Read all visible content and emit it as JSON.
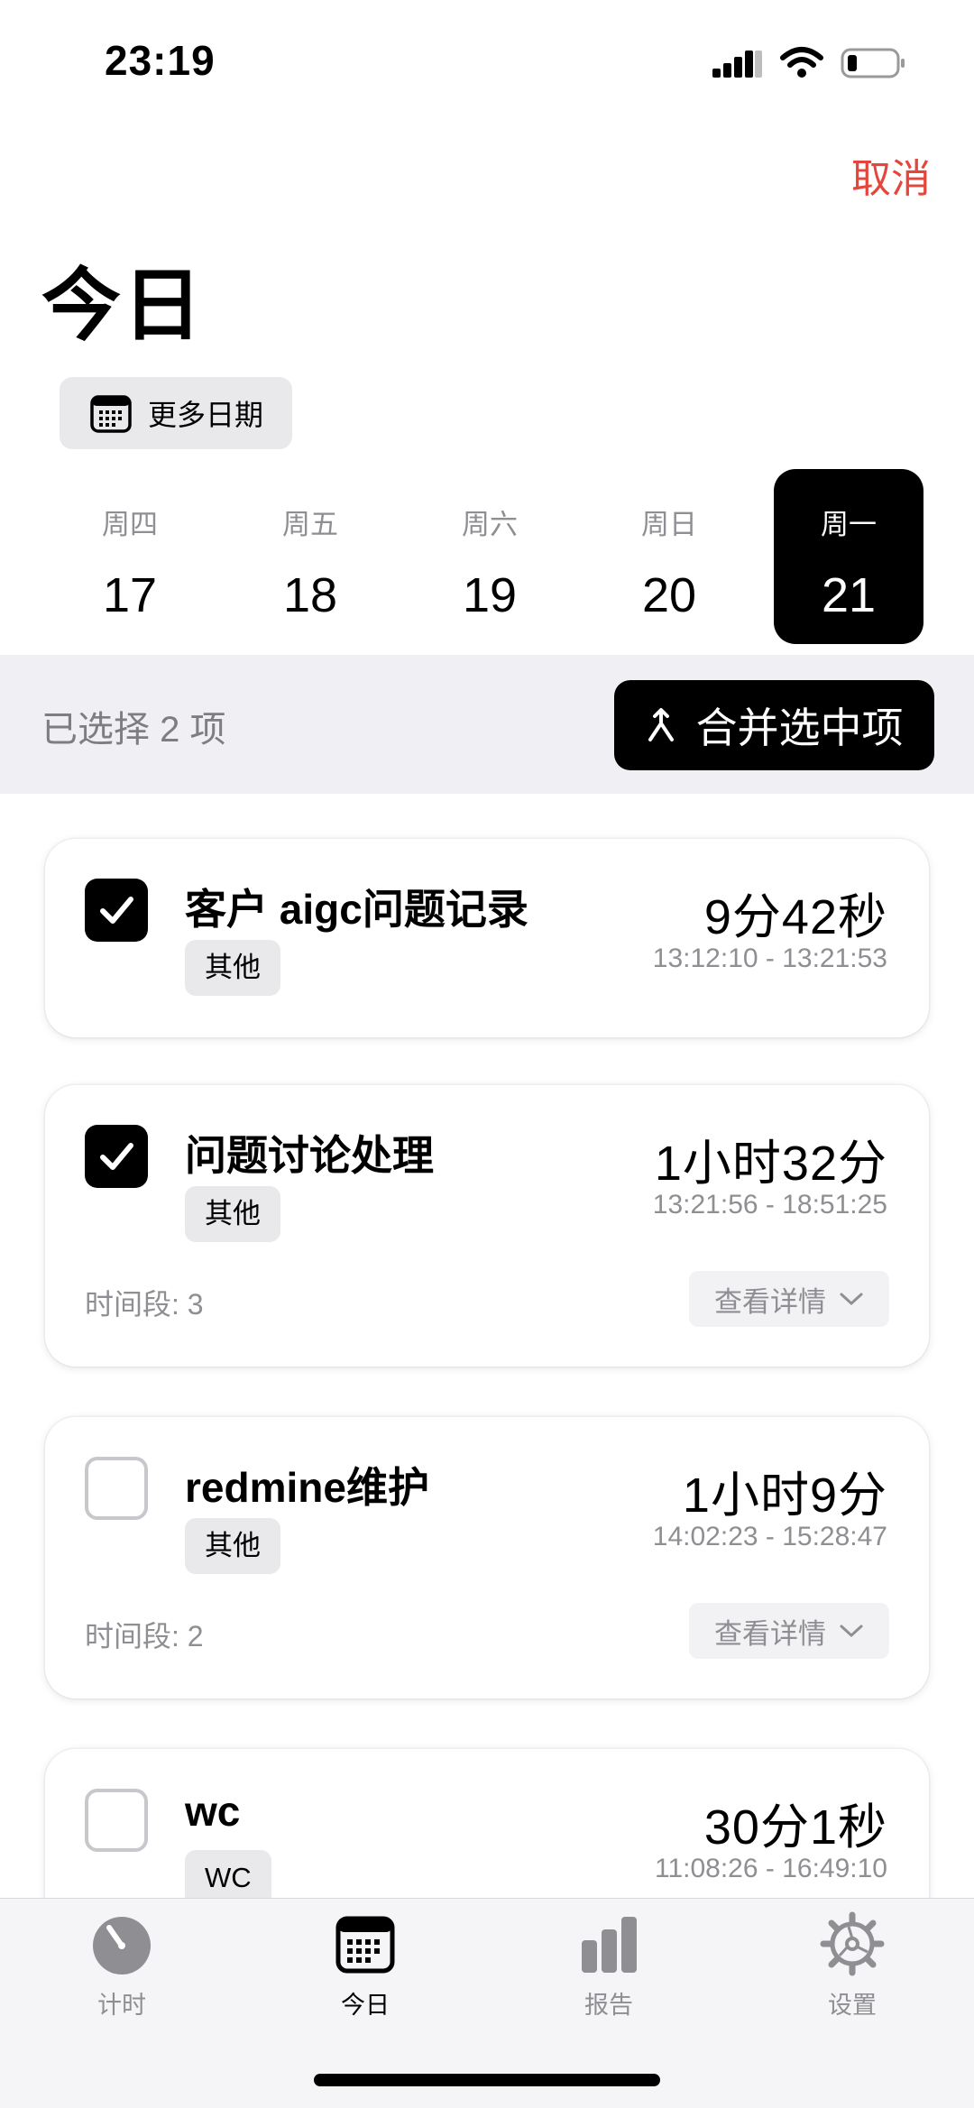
{
  "status_bar": {
    "time": "23:19"
  },
  "header": {
    "cancel_label": "取消",
    "title": "今日",
    "more_dates_label": "更多日期"
  },
  "week": [
    {
      "weekday": "周四",
      "day": "17",
      "selected": false
    },
    {
      "weekday": "周五",
      "day": "18",
      "selected": false
    },
    {
      "weekday": "周六",
      "day": "19",
      "selected": false
    },
    {
      "weekday": "周日",
      "day": "20",
      "selected": false
    },
    {
      "weekday": "周一",
      "day": "21",
      "selected": true
    }
  ],
  "selection": {
    "count_label": "已选择 2 项",
    "merge_label": "合并选中项"
  },
  "tasks": [
    {
      "name": "客户 aigc问题记录",
      "tag": "其他",
      "duration": "9分42秒",
      "range": "13:12:10 - 13:21:53",
      "checked": true
    },
    {
      "name": "问题讨论处理",
      "tag": "其他",
      "duration": "1小时32分",
      "range": "13:21:56 - 18:51:25",
      "checked": true,
      "segments": "时间段: 3",
      "details_label": "查看详情"
    },
    {
      "name": "redmine维护",
      "tag": "其他",
      "duration": "1小时9分",
      "range": "14:02:23 - 15:28:47",
      "checked": false,
      "segments": "时间段: 2",
      "details_label": "查看详情"
    },
    {
      "name": "wc",
      "tag": "WC",
      "duration": "30分1秒",
      "range": "11:08:26 - 16:49:10",
      "checked": false
    }
  ],
  "tab_bar": {
    "items": [
      {
        "label": "计时",
        "icon": "timer-icon",
        "active": false
      },
      {
        "label": "今日",
        "icon": "calendar-icon",
        "active": true
      },
      {
        "label": "报告",
        "icon": "bar-chart-icon",
        "active": false
      },
      {
        "label": "设置",
        "icon": "gear-icon",
        "active": false
      }
    ]
  },
  "colors": {
    "accent_red": "#e5453a",
    "selected_bg": "#000000",
    "muted_text": "#8e8e93"
  }
}
